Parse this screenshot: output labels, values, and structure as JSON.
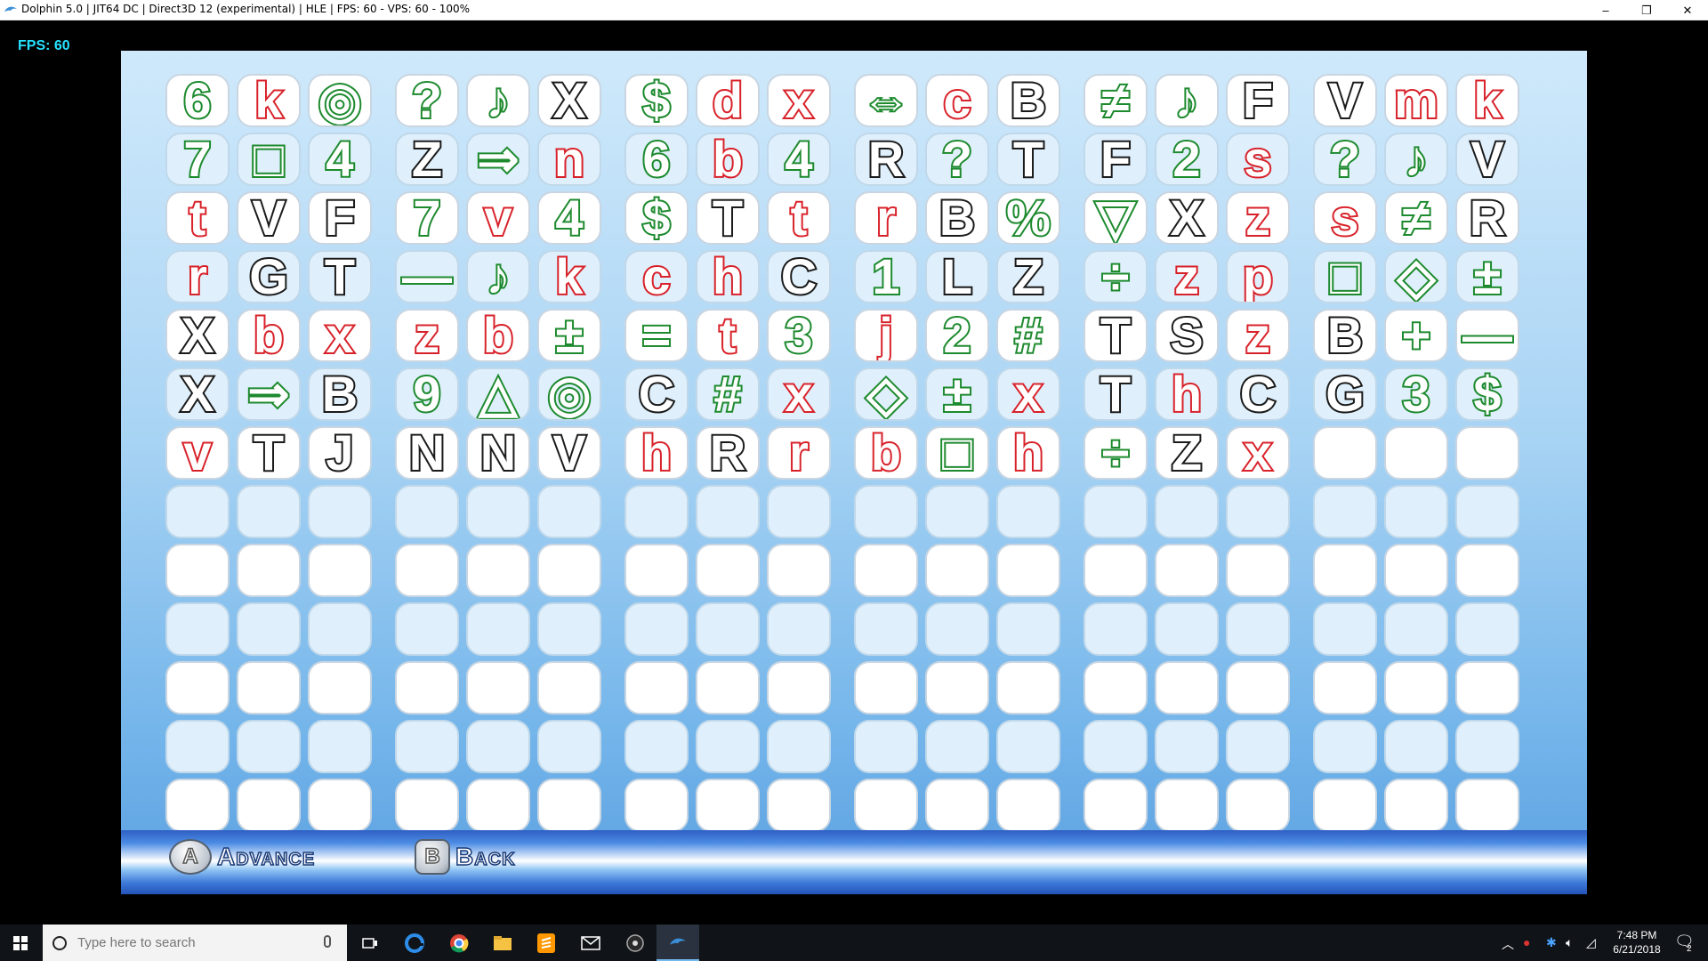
{
  "window": {
    "title": "Dolphin 5.0 | JIT64 DC | Direct3D 12 (experimental) | HLE | FPS: 60 - VPS: 60 - 100%",
    "minimize": "–",
    "maximize": "❐",
    "close": "✕"
  },
  "overlay": {
    "fps": "FPS: 60"
  },
  "grid": {
    "rows": [
      [
        "6",
        "k",
        "◎",
        "?",
        "♪",
        "X",
        "$",
        "d",
        "x",
        "⇔",
        "c",
        "B",
        "≠",
        "♪",
        "F",
        "V",
        "m",
        "k"
      ],
      [
        "7",
        "□",
        "4",
        "Z",
        "⇒",
        "n",
        "6",
        "b",
        "4",
        "R",
        "?",
        "T",
        "F",
        "2",
        "s",
        "?",
        "♪",
        "V"
      ],
      [
        "t",
        "V",
        "F",
        "7",
        "v",
        "4",
        "$",
        "T",
        "t",
        "r",
        "B",
        "%",
        "▽",
        "X",
        "z",
        "s",
        "≠",
        "R"
      ],
      [
        "r",
        "G",
        "T",
        "—",
        "♪",
        "k",
        "c",
        "h",
        "C",
        "1",
        "L",
        "Z",
        "÷",
        "z",
        "p",
        "□",
        "◇",
        "±"
      ],
      [
        "X",
        "b",
        "x",
        "z",
        "b",
        "±",
        "=",
        "t",
        "3",
        "j",
        "2",
        "#",
        "T",
        "S",
        "z",
        "B",
        "+",
        "—"
      ],
      [
        "X",
        "⇒",
        "B",
        "9",
        "△",
        "◎",
        "C",
        "#",
        "x",
        "◇",
        "±",
        "x",
        "T",
        "h",
        "C",
        "G",
        "3",
        "$"
      ],
      [
        "v",
        "T",
        "J",
        "N",
        "N",
        "V",
        "h",
        "R",
        "r",
        "b",
        "□",
        "h",
        "÷",
        "Z",
        "x",
        "",
        "",
        ""
      ],
      [
        "",
        "",
        "",
        "",
        "",
        "",
        "",
        "",
        "",
        "",
        "",
        "",
        "",
        "",
        "",
        "",
        "",
        ""
      ],
      [
        "",
        "",
        "",
        "",
        "",
        "",
        "",
        "",
        "",
        "",
        "",
        "",
        "",
        "",
        "",
        "",
        "",
        ""
      ],
      [
        "",
        "",
        "",
        "",
        "",
        "",
        "",
        "",
        "",
        "",
        "",
        "",
        "",
        "",
        "",
        "",
        "",
        ""
      ],
      [
        "",
        "",
        "",
        "",
        "",
        "",
        "",
        "",
        "",
        "",
        "",
        "",
        "",
        "",
        "",
        "",
        "",
        ""
      ],
      [
        "",
        "",
        "",
        "",
        "",
        "",
        "",
        "",
        "",
        "",
        "",
        "",
        "",
        "",
        "",
        "",
        "",
        ""
      ],
      [
        "",
        "",
        "",
        "",
        "",
        "",
        "",
        "",
        "",
        "",
        "",
        "",
        "",
        "",
        "",
        "",
        "",
        ""
      ]
    ],
    "colors": [
      [
        "g",
        "r",
        "g",
        "g",
        "g",
        "k",
        "g",
        "r",
        "r",
        "g",
        "r",
        "k",
        "g",
        "g",
        "k",
        "k",
        "r",
        "r"
      ],
      [
        "g",
        "g",
        "g",
        "k",
        "g",
        "r",
        "g",
        "r",
        "g",
        "k",
        "g",
        "k",
        "k",
        "g",
        "r",
        "g",
        "g",
        "k"
      ],
      [
        "r",
        "k",
        "k",
        "g",
        "r",
        "g",
        "g",
        "k",
        "r",
        "r",
        "k",
        "g",
        "g",
        "k",
        "r",
        "r",
        "g",
        "k"
      ],
      [
        "r",
        "k",
        "k",
        "g",
        "g",
        "r",
        "r",
        "r",
        "k",
        "g",
        "k",
        "k",
        "g",
        "r",
        "r",
        "g",
        "g",
        "g"
      ],
      [
        "k",
        "r",
        "r",
        "r",
        "r",
        "g",
        "g",
        "r",
        "g",
        "r",
        "g",
        "g",
        "k",
        "k",
        "r",
        "k",
        "g",
        "g"
      ],
      [
        "k",
        "g",
        "k",
        "g",
        "g",
        "g",
        "k",
        "g",
        "r",
        "g",
        "g",
        "r",
        "k",
        "r",
        "k",
        "k",
        "g",
        "g"
      ],
      [
        "r",
        "k",
        "k",
        "k",
        "k",
        "k",
        "r",
        "k",
        "r",
        "r",
        "g",
        "r",
        "g",
        "k",
        "r",
        "k",
        "k",
        "k"
      ]
    ]
  },
  "controls": {
    "a_button": "A",
    "a_label": "Advance",
    "b_button": "B",
    "b_label": "Back"
  },
  "taskbar": {
    "search_placeholder": "Type here to search",
    "time": "7:48 PM",
    "date": "6/21/2018",
    "notification_count": "2"
  }
}
